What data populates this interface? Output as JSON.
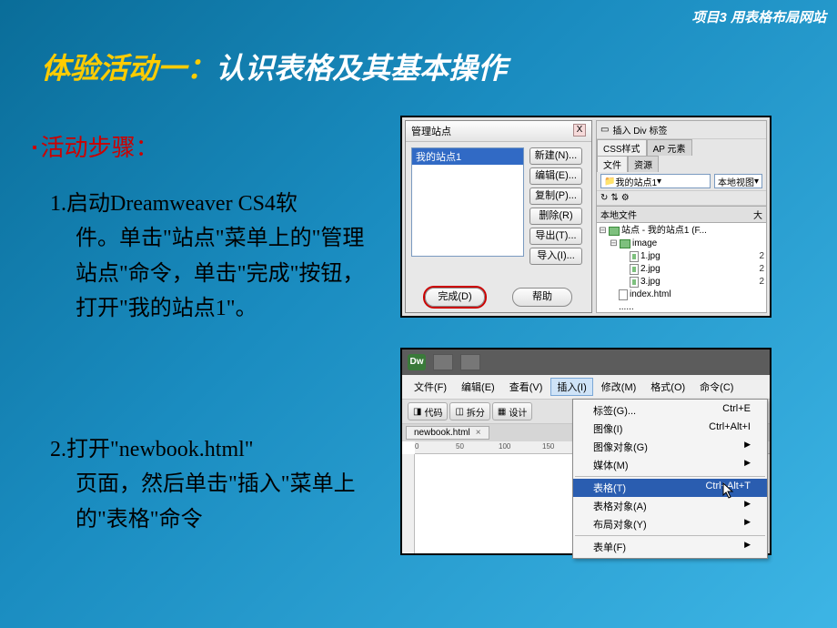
{
  "breadcrumb": "项目3  用表格布局网站",
  "title": {
    "part1": "体验活动一：",
    "part2": "认识表格及其基本操作"
  },
  "subtitle": "活动步骤：",
  "steps": {
    "s1_lead": "1.启动Dreamweaver CS4软",
    "s1_rest": "件。单击\"站点\"菜单上的\"管理站点\"命令，单击\"完成\"按钮，打开\"我的站点1\"。",
    "s2_lead": "2.打开\"newbook.html\"",
    "s2_rest": "页面，然后单击\"插入\"菜单上的\"表格\"命令"
  },
  "dlg": {
    "title": "管理站点",
    "close": "X",
    "selected": "我的站点1",
    "buttons": {
      "new": "新建(N)...",
      "edit": "编辑(E)...",
      "dup": "复制(P)...",
      "remove": "删除(R)",
      "export": "导出(T)...",
      "import": "导入(I)..."
    },
    "done": "完成(D)",
    "help": "帮助"
  },
  "panel": {
    "insert_hint": "插入 Div 标签",
    "tabs": {
      "css": "CSS样式",
      "ap": "AP 元素",
      "file": "文件",
      "res": "资源"
    },
    "site_combo": "我的站点1",
    "view_combo": "本地视图",
    "hdr": {
      "local": "本地文件",
      "size": "大"
    },
    "root": "站点 - 我的站点1 (F...",
    "folder": "image",
    "files": [
      {
        "name": "1.jpg",
        "size": "2"
      },
      {
        "name": "2.jpg",
        "size": "2"
      },
      {
        "name": "3.jpg",
        "size": "2"
      }
    ],
    "index": "index.html",
    "more": "......"
  },
  "dw": {
    "logo": "Dw",
    "menus": {
      "file": "文件(F)",
      "edit": "编辑(E)",
      "view": "查看(V)",
      "insert": "插入(I)",
      "modify": "修改(M)",
      "format": "格式(O)",
      "cmd": "命令(C)"
    },
    "toolbar": {
      "code": "代码",
      "split": "拆分",
      "design": "设计"
    },
    "tab": "newbook.html",
    "ruler": {
      "r0": "0",
      "r50": "50",
      "r100": "100",
      "r150": "150"
    },
    "menu": {
      "tag": {
        "label": "标签(G)...",
        "sc": "Ctrl+E"
      },
      "image": {
        "label": "图像(I)",
        "sc": "Ctrl+Alt+I"
      },
      "imgobj": {
        "label": "图像对象(G)",
        "sc": ""
      },
      "media": {
        "label": "媒体(M)",
        "sc": ""
      },
      "table": {
        "label": "表格(T)",
        "sc": "Ctrl+Alt+T"
      },
      "tblobj": {
        "label": "表格对象(A)",
        "sc": ""
      },
      "layout": {
        "label": "布局对象(Y)",
        "sc": ""
      },
      "form": {
        "label": "表单(F)",
        "sc": ""
      }
    }
  }
}
